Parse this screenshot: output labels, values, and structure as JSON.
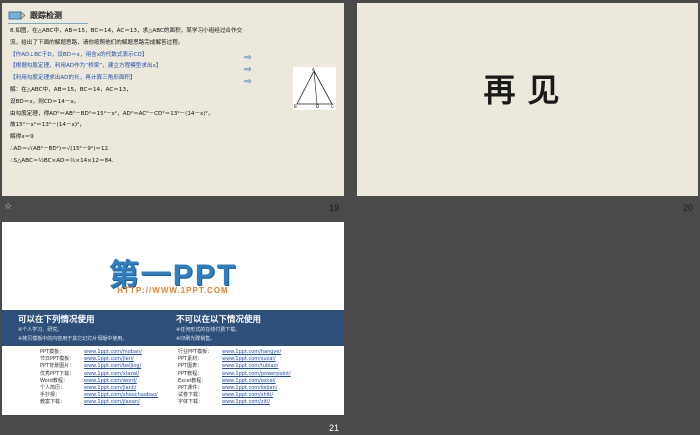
{
  "slide19": {
    "number": "19",
    "header_title": "跟踪检测",
    "lines": [
      "8.如图，在△ABC中，AB＝15，BC＝14，AC＝13，求△ABC的面积，某学习小组经过合作交",
      "流，给出了下面的解题思路，请你按照他们的解题思路完成解答过程。",
      "【作AD⊥BC于D，设BD＝x，用含x的代数式表示CD】",
      "【根据勾股定理，利用AD作为“桥梁”，建立方程模型求出x】",
      "【利用勾股定理求出AD的长，再计算三角形面积】",
      "解：在△ABC中，AB＝15，BC＝14，AC＝13，",
      "设BD＝x，则CD＝14－x。",
      "由勾股定理，得AD²＝AB²－BD²＝15²－x²，AD²＝AC²－CD²＝13²－(14－x)²，",
      "故15²－x²＝13²－(14－x)²，",
      "解得x＝9",
      "∴AD＝√(AB²－BD²)＝√(15²－9²)＝12.",
      "∴S△ABC＝½BC×AD＝½×14×12＝84."
    ],
    "figure_labels": {
      "a": "A",
      "b": "B",
      "c": "C",
      "d": "D"
    }
  },
  "slide20": {
    "number": "20",
    "text": "再见"
  },
  "slide21": {
    "number": "21",
    "logo": "第一PPT",
    "url": "HTTP://WWW.1PPT.COM",
    "left_heading": "可以在下列情况使用",
    "left_items": [
      "※个人学习、研究。",
      "※拷贝模板中的内容用于其它幻灯片母版中使用。"
    ],
    "right_heading": "不可以在以下情况使用",
    "right_items": [
      "※任何形式的在线付费下载。",
      "※印刷光碟销售。"
    ],
    "left_links": [
      {
        "k": "PPT模板：",
        "v": "www.1ppt.com/moban/"
      },
      {
        "k": "节日PPT模板：",
        "v": "www.1ppt.com/jieri/"
      },
      {
        "k": "PPT背景图片：",
        "v": "www.1ppt.com/beijing/"
      },
      {
        "k": "优秀PPT下载：",
        "v": "www.1ppt.com/xiazai/"
      },
      {
        "k": "Word教程：",
        "v": "www.1ppt.com/word/"
      },
      {
        "k": "个人简历：",
        "v": "www.1ppt.com/jianli/"
      },
      {
        "k": "手抄报：",
        "v": "www.1ppt.com/shouchaobao/"
      },
      {
        "k": "教案下载：",
        "v": "www.1ppt.com/jiaoan/"
      }
    ],
    "right_links": [
      {
        "k": "行业PPT模板：",
        "v": "www.1ppt.com/hangye/"
      },
      {
        "k": "PPT素材：",
        "v": "www.1ppt.com/sucai/"
      },
      {
        "k": "PPT图表：",
        "v": "www.1ppt.com/tubiao/"
      },
      {
        "k": "PPT教程：",
        "v": "www.1ppt.com/powerpoint/"
      },
      {
        "k": "Excel教程：",
        "v": "www.1ppt.com/excel/"
      },
      {
        "k": "PPT课件：",
        "v": "www.1ppt.com/kejian/"
      },
      {
        "k": "试卷下载：",
        "v": "www.1ppt.com/shiti/"
      },
      {
        "k": "字体下载：",
        "v": "www.1ppt.com/ziti/"
      }
    ]
  }
}
